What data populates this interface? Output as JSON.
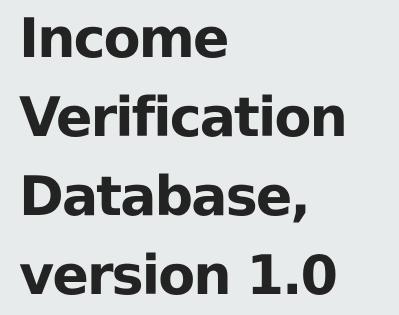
{
  "title": {
    "lines": [
      "Income",
      "Verification",
      "Database,",
      "version 1.0"
    ]
  },
  "colors": {
    "background": "#e8ebec",
    "text": "#232323"
  }
}
